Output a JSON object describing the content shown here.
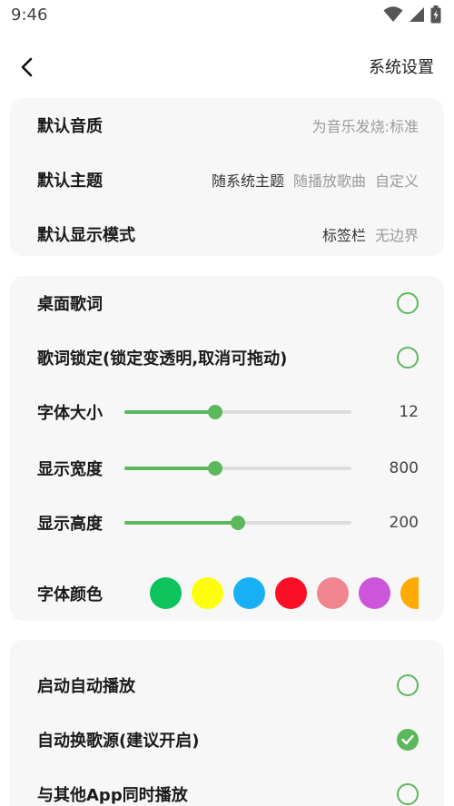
{
  "status_bar": {
    "time": "9:46",
    "icons": [
      "wifi-icon",
      "signal-icon",
      "battery-icon"
    ]
  },
  "header": {
    "back_icon": "chevron-left-icon",
    "title": "系统设置"
  },
  "playback_section": {
    "quality": {
      "label": "默认音质",
      "value": "为音乐发烧:标准"
    },
    "theme": {
      "label": "默认主题",
      "options": [
        "随系统主题",
        "随播放歌曲",
        "自定义"
      ],
      "selected": "随系统主题"
    },
    "display_mode": {
      "label": "默认显示模式",
      "options": [
        "标签栏",
        "无边界"
      ],
      "selected": "标签栏"
    }
  },
  "lyrics_section": {
    "desktop_lyrics": {
      "label": "桌面歌词",
      "checked": false
    },
    "lyrics_lock": {
      "label": "歌词锁定(锁定变透明,取消可拖动)",
      "checked": false
    },
    "font_size": {
      "label": "字体大小",
      "value": "12",
      "level": 0.4
    },
    "display_width": {
      "label": "显示宽度",
      "value": "800",
      "level": 0.4
    },
    "display_height": {
      "label": "显示高度",
      "value": "200",
      "level": 0.5
    },
    "font_color": {
      "label": "字体颜色",
      "colors": [
        "#0dc35c",
        "#fefe0c",
        "#18b0f5",
        "#fb0f24",
        "#f0858f",
        "#cc55d9",
        "#ffaa00"
      ]
    }
  },
  "general_section": {
    "auto_play": {
      "label": "启动自动播放",
      "checked": false
    },
    "auto_switch_source": {
      "label": "自动换歌源(建议开启)",
      "checked": true
    },
    "mix_with_others": {
      "label": "与其他App同时播放",
      "checked": false
    }
  },
  "colors": {
    "accent": "#5cb85c",
    "card_bg": "#f7f7f7",
    "inactive_text": "#9a9a9a"
  }
}
